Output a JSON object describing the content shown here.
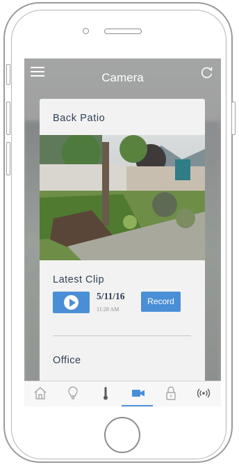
{
  "header": {
    "title": "Camera",
    "menu_icon": "hamburger-menu-icon",
    "refresh_icon": "refresh-icon"
  },
  "camera_card": {
    "name": "Back Patio",
    "snapshot": "camera-snapshot-back-patio",
    "latest_clip": {
      "heading": "Latest Clip",
      "date": "5/11/16",
      "time": "11:28 AM",
      "play_icon": "play-icon",
      "record_label": "Record"
    }
  },
  "next_camera": {
    "name": "Office"
  },
  "tabbar": {
    "items": [
      {
        "icon": "home-icon",
        "active": false
      },
      {
        "icon": "lightbulb-icon",
        "active": false
      },
      {
        "icon": "thermometer-icon",
        "active": false
      },
      {
        "icon": "video-camera-icon",
        "active": true
      },
      {
        "icon": "lock-icon",
        "active": false
      },
      {
        "icon": "wireless-signal-icon",
        "active": false
      }
    ]
  },
  "colors": {
    "accent": "#4a8fd6",
    "heading_text": "#2e3e54",
    "card_bg": "#f2f2f2",
    "header_bg": "#a0a1a0"
  }
}
